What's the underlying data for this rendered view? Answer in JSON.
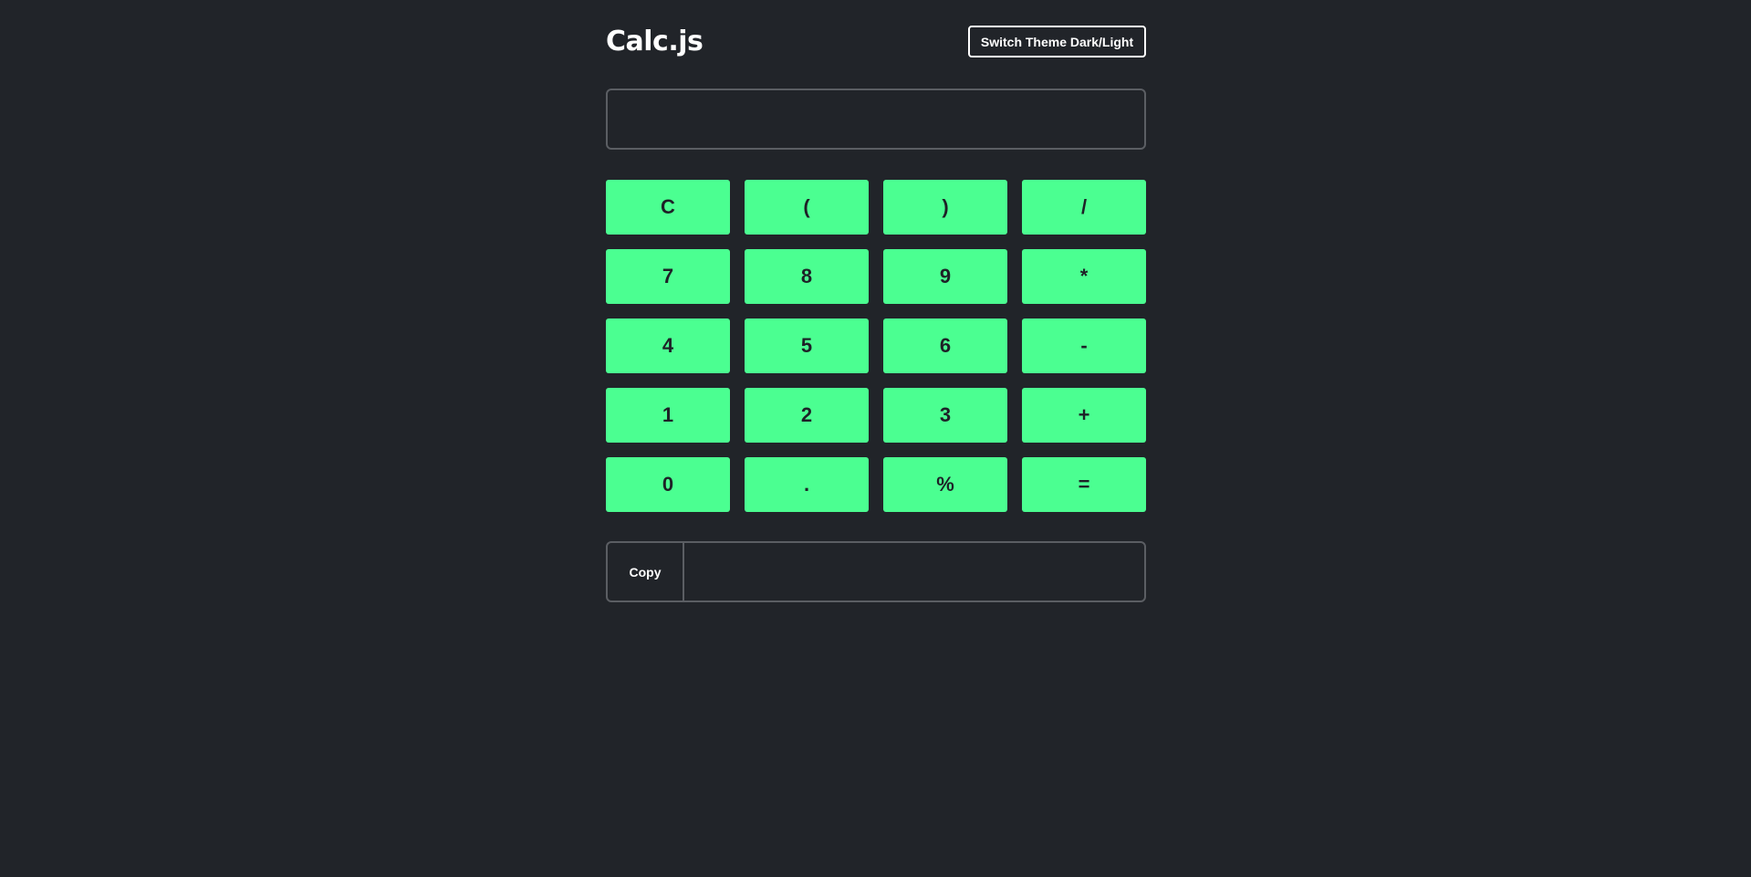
{
  "app": {
    "title": "Calc.js",
    "theme_button_label": "Switch Theme Dark/Light"
  },
  "display": {
    "value": ""
  },
  "keypad": {
    "keys": [
      {
        "label": "C"
      },
      {
        "label": "("
      },
      {
        "label": ")"
      },
      {
        "label": "/"
      },
      {
        "label": "7"
      },
      {
        "label": "8"
      },
      {
        "label": "9"
      },
      {
        "label": "*"
      },
      {
        "label": "4"
      },
      {
        "label": "5"
      },
      {
        "label": "6"
      },
      {
        "label": "-"
      },
      {
        "label": "1"
      },
      {
        "label": "2"
      },
      {
        "label": "3"
      },
      {
        "label": "+"
      },
      {
        "label": "0"
      },
      {
        "label": "."
      },
      {
        "label": "%"
      },
      {
        "label": "="
      }
    ]
  },
  "copy": {
    "button_label": "Copy",
    "result_value": ""
  },
  "colors": {
    "background": "#212429",
    "key_accent": "#4bff91",
    "border": "#5b5e63"
  }
}
